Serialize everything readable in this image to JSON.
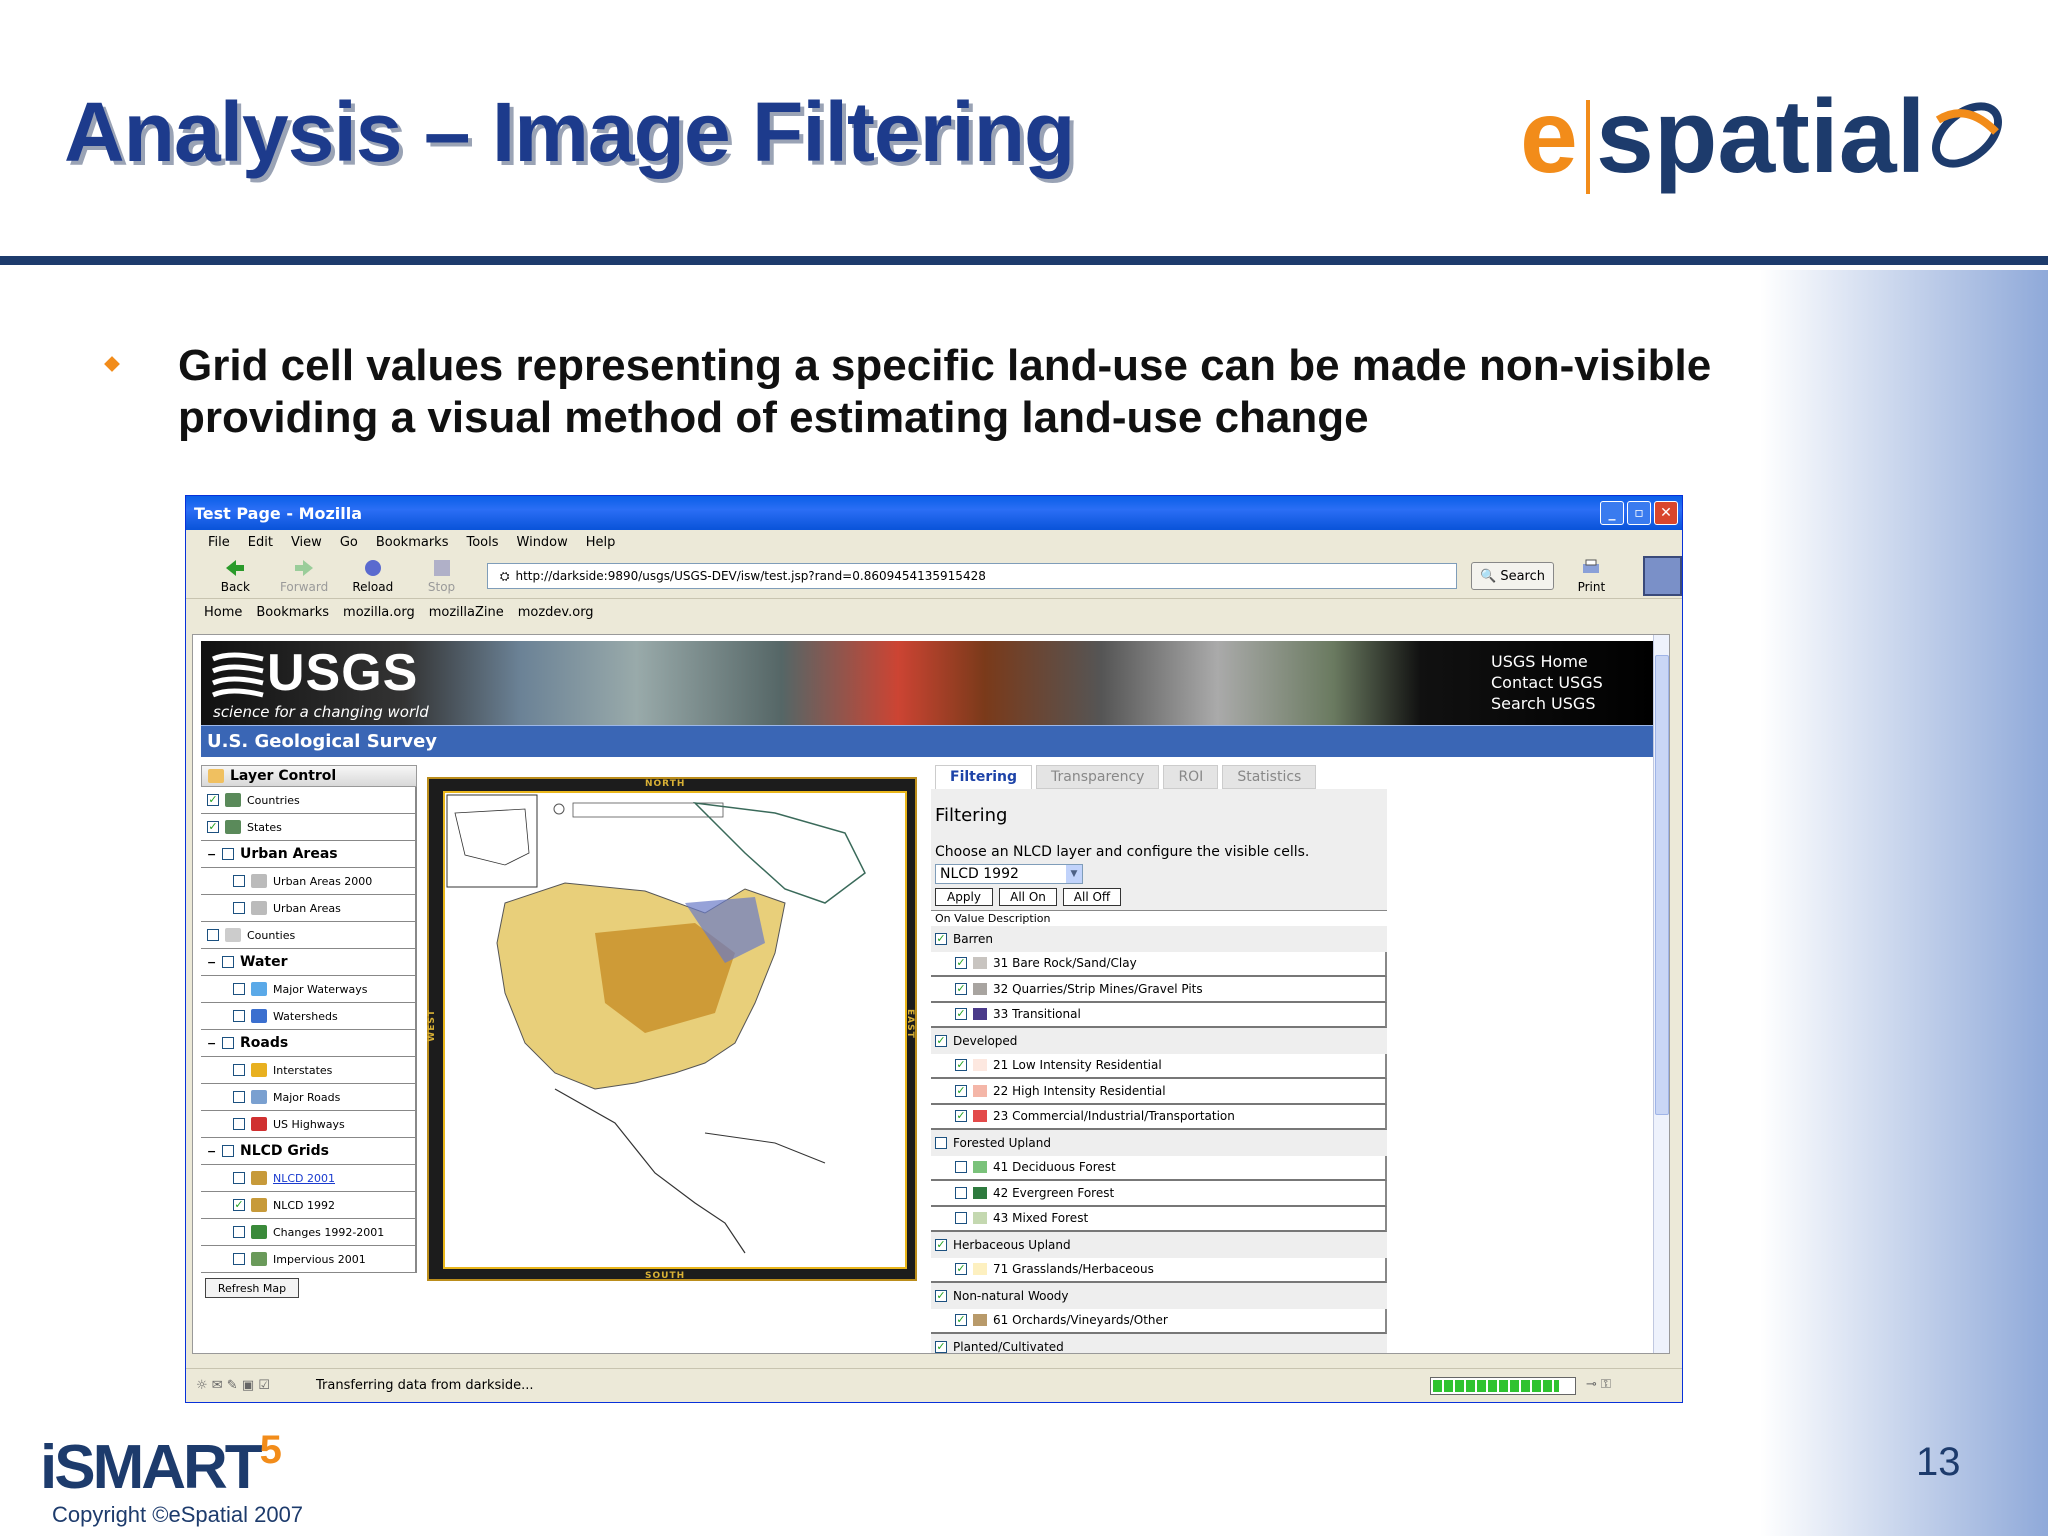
{
  "slide": {
    "title": "Analysis – Image Filtering",
    "bullet": "Grid cell values representing a specific land-use can be made non-visible providing a visual method of estimating land-use change",
    "page_number": "13",
    "copyright": "Copyright ©eSpatial 2007",
    "footer_logo": "iSMART",
    "footer_logo_sup": "5",
    "brand_e": "e",
    "brand_rest": "spatial"
  },
  "browser": {
    "title": "Test Page - Mozilla",
    "menu": [
      "File",
      "Edit",
      "View",
      "Go",
      "Bookmarks",
      "Tools",
      "Window",
      "Help"
    ],
    "nav": {
      "back": "Back",
      "forward": "Forward",
      "reload": "Reload",
      "stop": "Stop",
      "print": "Print",
      "search": "Search"
    },
    "url": "http://darkside:9890/usgs/USGS-DEV/isw/test.jsp?rand=0.8609454135915428",
    "bookmarks": [
      "Home",
      "Bookmarks",
      "mozilla.org",
      "mozillaZine",
      "mozdev.org"
    ],
    "status": "Transferring data from darkside...",
    "progress": 0.9
  },
  "usgs": {
    "logo": "USGS",
    "tagline": "science for a changing world",
    "links": [
      "USGS Home",
      "Contact USGS",
      "Search USGS"
    ],
    "bar": "U.S. Geological Survey"
  },
  "layers": {
    "title": "Layer Control",
    "refresh": "Refresh Map",
    "rows": [
      {
        "label": "Countries",
        "checked": true,
        "group": false,
        "color": "#5a8a5a"
      },
      {
        "label": "States",
        "checked": true,
        "group": false,
        "color": "#5a8a5a"
      },
      {
        "label": "Urban Areas",
        "checked": false,
        "group": true
      },
      {
        "label": "Urban Areas 2000",
        "checked": false,
        "group": false,
        "color": "#bbbbbb",
        "indent": true
      },
      {
        "label": "Urban Areas",
        "checked": false,
        "group": false,
        "color": "#bbbbbb",
        "indent": true
      },
      {
        "label": "Counties",
        "checked": false,
        "group": false,
        "color": "#cccccc"
      },
      {
        "label": "Water",
        "checked": false,
        "group": true
      },
      {
        "label": "Major Waterways",
        "checked": false,
        "group": false,
        "color": "#5aa9e8",
        "indent": true
      },
      {
        "label": "Watersheds",
        "checked": false,
        "group": false,
        "color": "#3b6fcf",
        "indent": true
      },
      {
        "label": "Roads",
        "checked": false,
        "group": true
      },
      {
        "label": "Interstates",
        "checked": false,
        "group": false,
        "color": "#e8b020",
        "indent": true
      },
      {
        "label": "Major Roads",
        "checked": false,
        "group": false,
        "color": "#7aa0d0",
        "indent": true
      },
      {
        "label": "US Highways",
        "checked": false,
        "group": false,
        "color": "#d03030",
        "indent": true
      },
      {
        "label": "NLCD Grids",
        "checked": false,
        "group": true
      },
      {
        "label": "NLCD 2001",
        "checked": false,
        "group": false,
        "color": "#c79a3a",
        "indent": true,
        "link": true
      },
      {
        "label": "NLCD 1992",
        "checked": true,
        "group": false,
        "color": "#c79a3a",
        "indent": true
      },
      {
        "label": "Changes 1992-2001",
        "checked": false,
        "group": false,
        "color": "#3a8a3a",
        "indent": true
      },
      {
        "label": "Impervious 2001",
        "checked": false,
        "group": false,
        "color": "#6a9a5a",
        "indent": true
      }
    ]
  },
  "map": {
    "north": "NORTH",
    "south": "SOUTH",
    "east": "EAST",
    "west": "WEST"
  },
  "tabs": [
    "Filtering",
    "Transparency",
    "ROI",
    "Statistics"
  ],
  "filtering": {
    "title": "Filtering",
    "desc": "Choose an NLCD layer and configure the visible cells.",
    "selected": "NLCD 1992",
    "buttons": [
      "Apply",
      "All On",
      "All Off"
    ],
    "header": "On  Value Description",
    "rows": [
      {
        "label": "Barren",
        "cat": true,
        "checked": true
      },
      {
        "label": "31 Bare Rock/Sand/Clay",
        "checked": true,
        "color": "#c8c4c0"
      },
      {
        "label": "32 Quarries/Strip Mines/Gravel Pits",
        "checked": true,
        "color": "#a8a4a0"
      },
      {
        "label": "33 Transitional",
        "checked": true,
        "color": "#4a3a8a"
      },
      {
        "label": "Developed",
        "cat": true,
        "checked": true
      },
      {
        "label": "21 Low Intensity Residential",
        "checked": true,
        "color": "#fde8e0"
      },
      {
        "label": "22 High Intensity Residential",
        "checked": true,
        "color": "#f4b6a8"
      },
      {
        "label": "23 Commercial/Industrial/Transportation",
        "checked": true,
        "color": "#e34a4a"
      },
      {
        "label": "Forested Upland",
        "cat": true,
        "checked": false
      },
      {
        "label": "41 Deciduous Forest",
        "checked": false,
        "color": "#7ac27a"
      },
      {
        "label": "42 Evergreen Forest",
        "checked": false,
        "color": "#2e7a3e"
      },
      {
        "label": "43 Mixed Forest",
        "checked": false,
        "color": "#c4d8b0"
      },
      {
        "label": "Herbaceous Upland",
        "cat": true,
        "checked": true
      },
      {
        "label": "71 Grasslands/Herbaceous",
        "checked": true,
        "color": "#fdf0c0"
      },
      {
        "label": "Non-natural Woody",
        "cat": true,
        "checked": true
      },
      {
        "label": "61 Orchards/Vineyards/Other",
        "checked": true,
        "color": "#b89a6a"
      },
      {
        "label": "Planted/Cultivated",
        "cat": true,
        "checked": true
      }
    ]
  }
}
